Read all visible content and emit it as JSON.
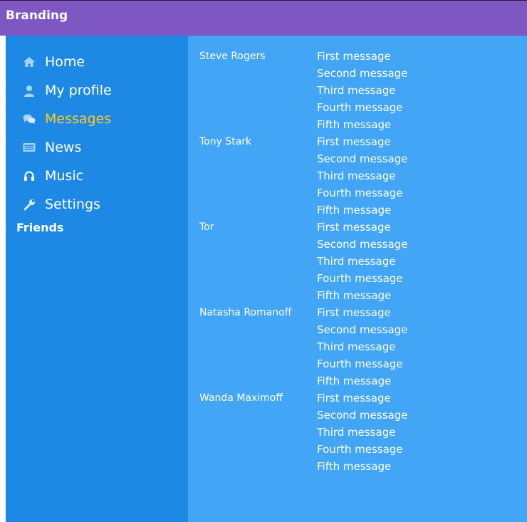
{
  "header": {
    "brand": "Branding"
  },
  "colors": {
    "header_bg": "#7e57c2",
    "sidebar_bg": "#1e88e5",
    "content_bg": "#42a5f5",
    "active_link": "#ffca28",
    "text": "#ffffff"
  },
  "sidebar": {
    "items": [
      {
        "label": "Home",
        "icon": "home-icon",
        "active": false
      },
      {
        "label": "My profile",
        "icon": "user-icon",
        "active": false
      },
      {
        "label": "Messages",
        "icon": "chat-icon",
        "active": true
      },
      {
        "label": "News",
        "icon": "newspaper-icon",
        "active": false
      },
      {
        "label": "Music",
        "icon": "headphones-icon",
        "active": false
      },
      {
        "label": "Settings",
        "icon": "wrench-icon",
        "active": false
      }
    ],
    "friends_label": "Friends"
  },
  "dialogs": [
    {
      "name": "Steve Rogers"
    },
    {
      "name": "Tony Stark"
    },
    {
      "name": "Tor"
    },
    {
      "name": "Natasha Romanoff"
    },
    {
      "name": "Wanda Maximoff"
    }
  ],
  "messages": [
    "First message",
    "Second message",
    "Third message",
    "Fourth message",
    "Fifth message",
    "First message",
    "Second message",
    "Third message",
    "Fourth message",
    "Fifth message",
    "First message",
    "Second message",
    "Third message",
    "Fourth message",
    "Fifth message",
    "First message",
    "Second message",
    "Third message",
    "Fourth message",
    "Fifth message",
    "First message",
    "Second message",
    "Third message",
    "Fourth message",
    "Fifth message"
  ]
}
